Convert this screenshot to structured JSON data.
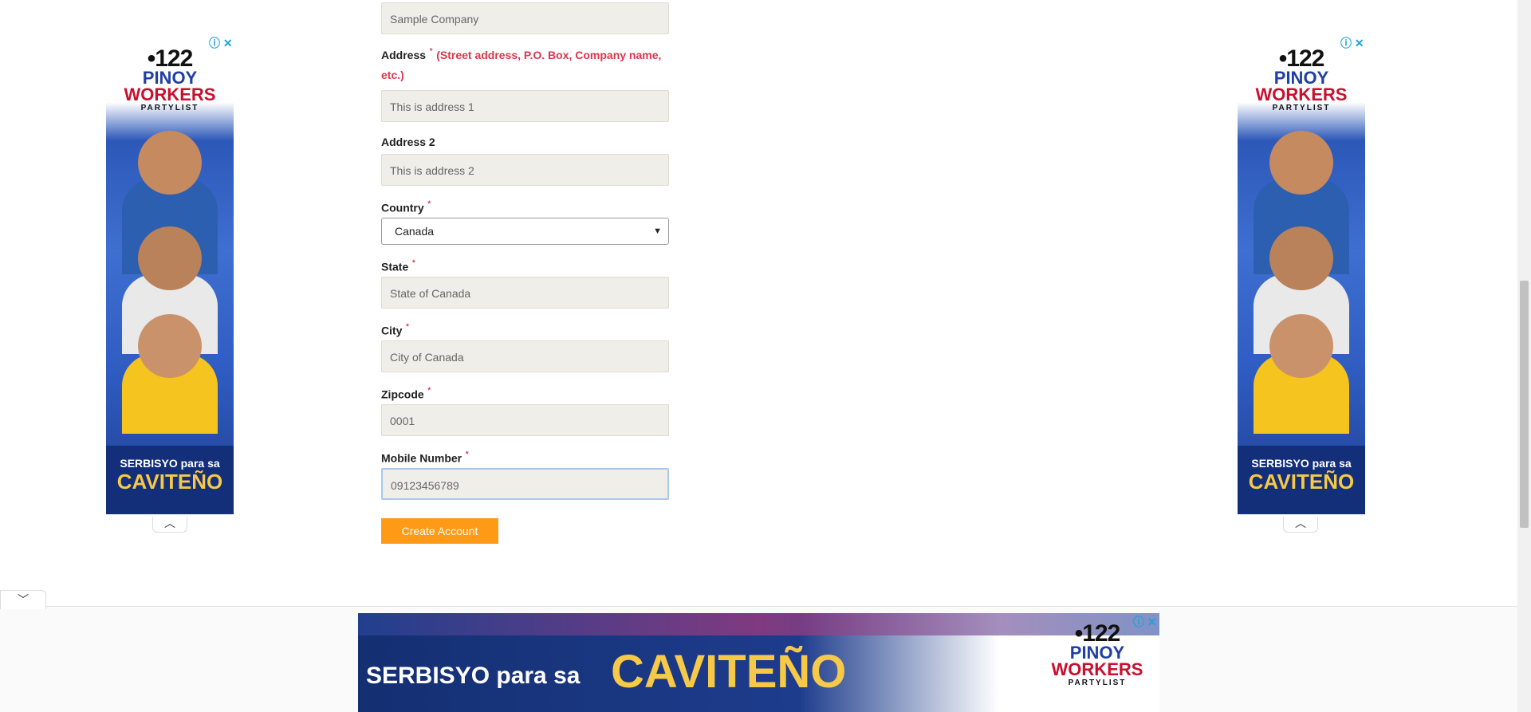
{
  "form": {
    "company": {
      "value": "Sample Company"
    },
    "address": {
      "label": "Address",
      "required": "*",
      "hint": "(Street address, P.O. Box, Company name, etc.)",
      "value": "This is address 1"
    },
    "address2": {
      "label": "Address 2",
      "value": "This is address 2"
    },
    "country": {
      "label": "Country",
      "required": "*",
      "selected": "Canada"
    },
    "state": {
      "label": "State",
      "required": "*",
      "value": "State of Canada"
    },
    "city": {
      "label": "City",
      "required": "*",
      "value": "City of Canada"
    },
    "zipcode": {
      "label": "Zipcode",
      "required": "*",
      "value": "0001"
    },
    "mobile": {
      "label": "Mobile Number",
      "required": "*",
      "value": "09123456789"
    },
    "submit_label": "Create Account"
  },
  "ad": {
    "number": "•122",
    "line1": "PINOY",
    "line2": "WORKERS",
    "line3": "PARTYLIST",
    "slogan1": "SERBISYO para sa",
    "slogan2": "CAVITEÑO",
    "close_glyph": "ⓘ ✕",
    "collapse_glyph": "︿",
    "expand_glyph": "﹀"
  },
  "colors": {
    "accent_button": "#ff9a17",
    "required_hint": "#e0344b"
  }
}
